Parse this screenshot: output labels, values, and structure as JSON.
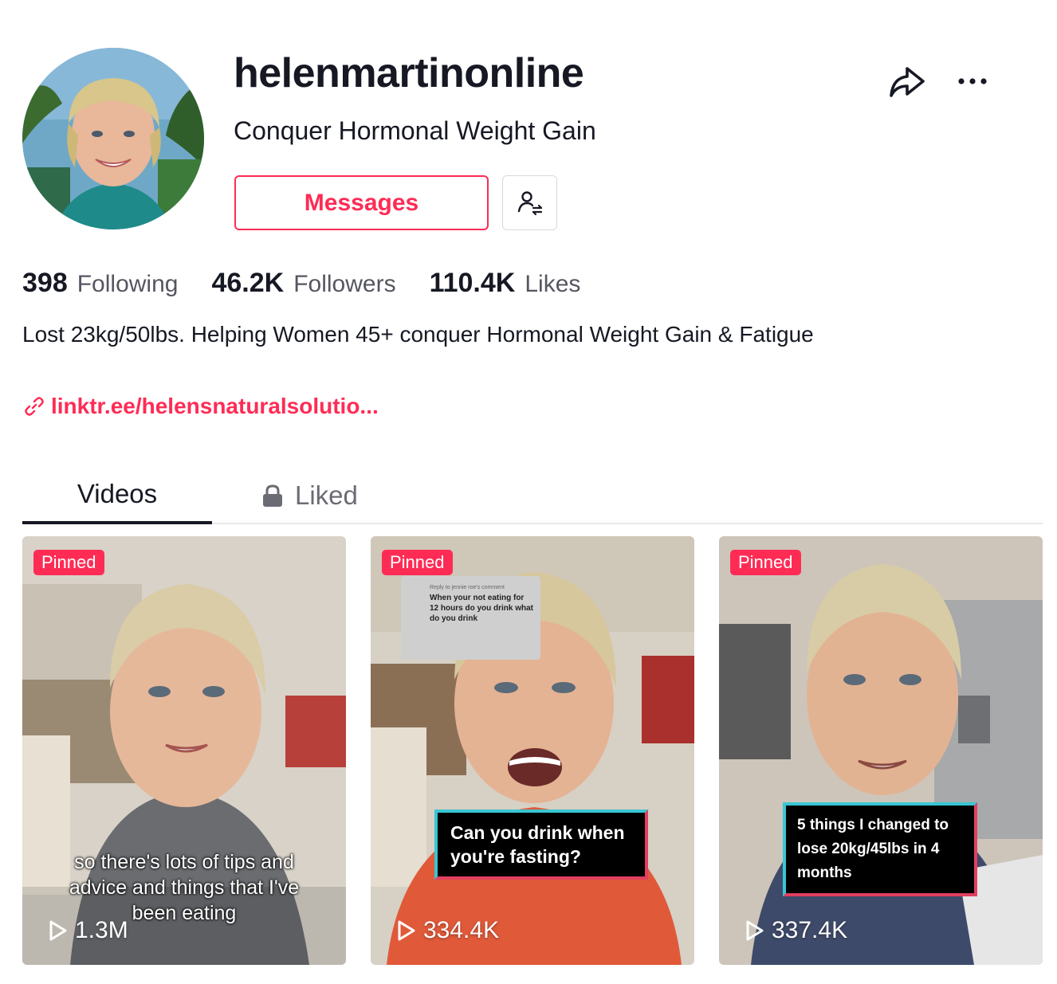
{
  "profile": {
    "username": "helenmartinonline",
    "nickname": "Conquer Hormonal Weight Gain",
    "messages_label": "Messages",
    "stats": [
      {
        "value": "398",
        "label": "Following"
      },
      {
        "value": "46.2K",
        "label": "Followers"
      },
      {
        "value": "110.4K",
        "label": "Likes"
      }
    ],
    "bio": "Lost 23kg/50lbs. Helping Women 45+ conquer Hormonal Weight Gain & Fatigue",
    "link": "linktr.ee/helensnaturalsolutio..."
  },
  "tabs": [
    {
      "label": "Videos",
      "active": true
    },
    {
      "label": "Liked",
      "locked": true
    }
  ],
  "videos": [
    {
      "pinned_label": "Pinned",
      "views": "1.3M",
      "caption": "so there's lots of tips and advice and things that I've been eating"
    },
    {
      "pinned_label": "Pinned",
      "views": "334.4K",
      "reply_header": "Reply to jennie roe's comment",
      "reply_text": "When your not eating for 12 hours do you drink what do you drink",
      "overlay": "Can you drink when you're fasting?"
    },
    {
      "pinned_label": "Pinned",
      "views": "337.4K",
      "overlay": "5 things I changed to lose 20kg/45lbs in 4 months"
    }
  ],
  "colors": {
    "accent": "#fe2c55",
    "text": "#161823",
    "muted": "#555660"
  },
  "icons": [
    "share-icon",
    "more-icon",
    "follow-swap-icon",
    "link-icon",
    "lock-icon",
    "play-icon"
  ]
}
